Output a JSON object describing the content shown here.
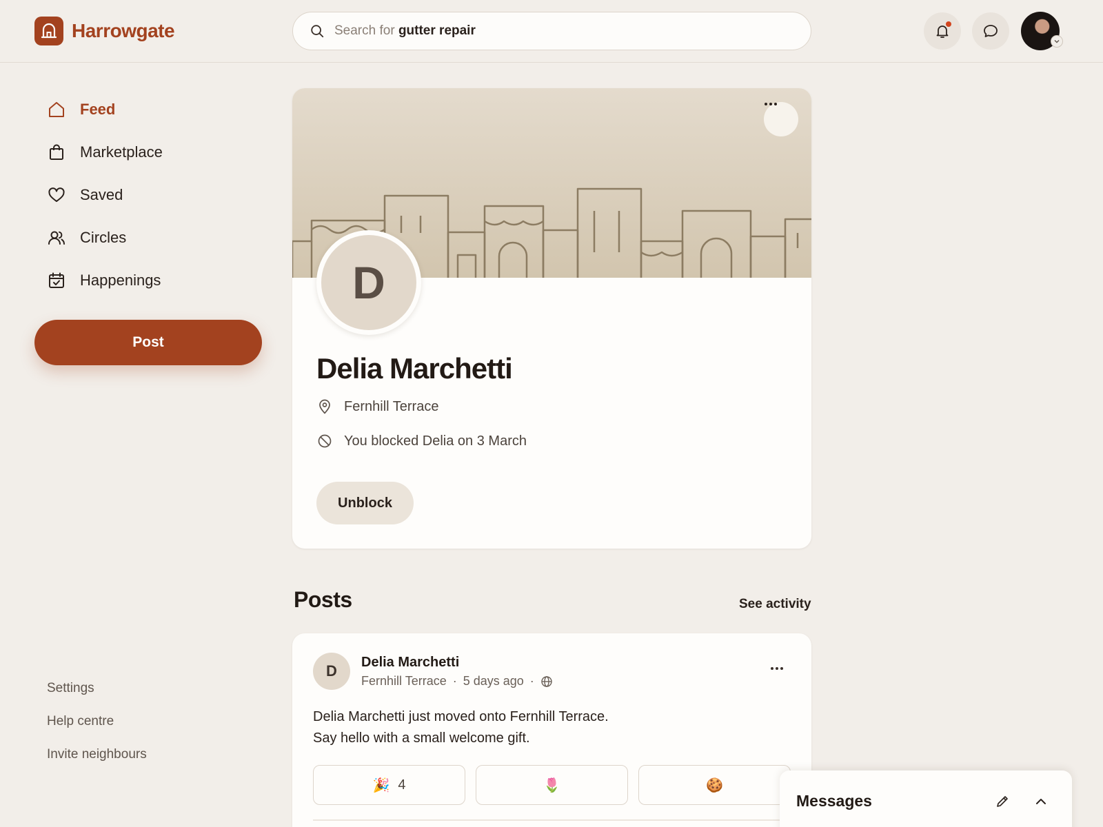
{
  "app": {
    "name": "Harrowgate"
  },
  "search": {
    "prefix": "Search for",
    "query": "gutter repair"
  },
  "colors": {
    "brand": "#a3421f",
    "background": "#f2eee9",
    "card": "#fefdfb",
    "notification": "#d2451e"
  },
  "sidebar": {
    "items": [
      {
        "label": "Feed",
        "icon": "home-icon",
        "active": true
      },
      {
        "label": "Marketplace",
        "icon": "shopping-bag-icon",
        "active": false
      },
      {
        "label": "Saved",
        "icon": "heart-icon",
        "active": false
      },
      {
        "label": "Circles",
        "icon": "people-icon",
        "active": false
      },
      {
        "label": "Happenings",
        "icon": "calendar-check-icon",
        "active": false
      }
    ],
    "post_button": "Post",
    "footer_links": [
      "Settings",
      "Help centre",
      "Invite neighbours"
    ]
  },
  "profile": {
    "initial": "D",
    "name": "Delia Marchetti",
    "location": "Fernhill Terrace",
    "blocked_status": "You blocked Delia on 3 March",
    "unblock_label": "Unblock"
  },
  "posts_section": {
    "title": "Posts",
    "see_activity": "See activity"
  },
  "post": {
    "initial": "D",
    "author": "Delia Marchetti",
    "location": "Fernhill Terrace",
    "time": "5 days ago",
    "separator": "·",
    "body_line1": "Delia Marchetti just moved onto Fernhill Terrace.",
    "body_line2": "Say hello with a small welcome gift.",
    "reactions": [
      {
        "emoji": "🎉",
        "count": "4"
      },
      {
        "emoji": "🌷",
        "count": ""
      },
      {
        "emoji": "🍪",
        "count": ""
      }
    ]
  },
  "messages": {
    "title": "Messages"
  }
}
